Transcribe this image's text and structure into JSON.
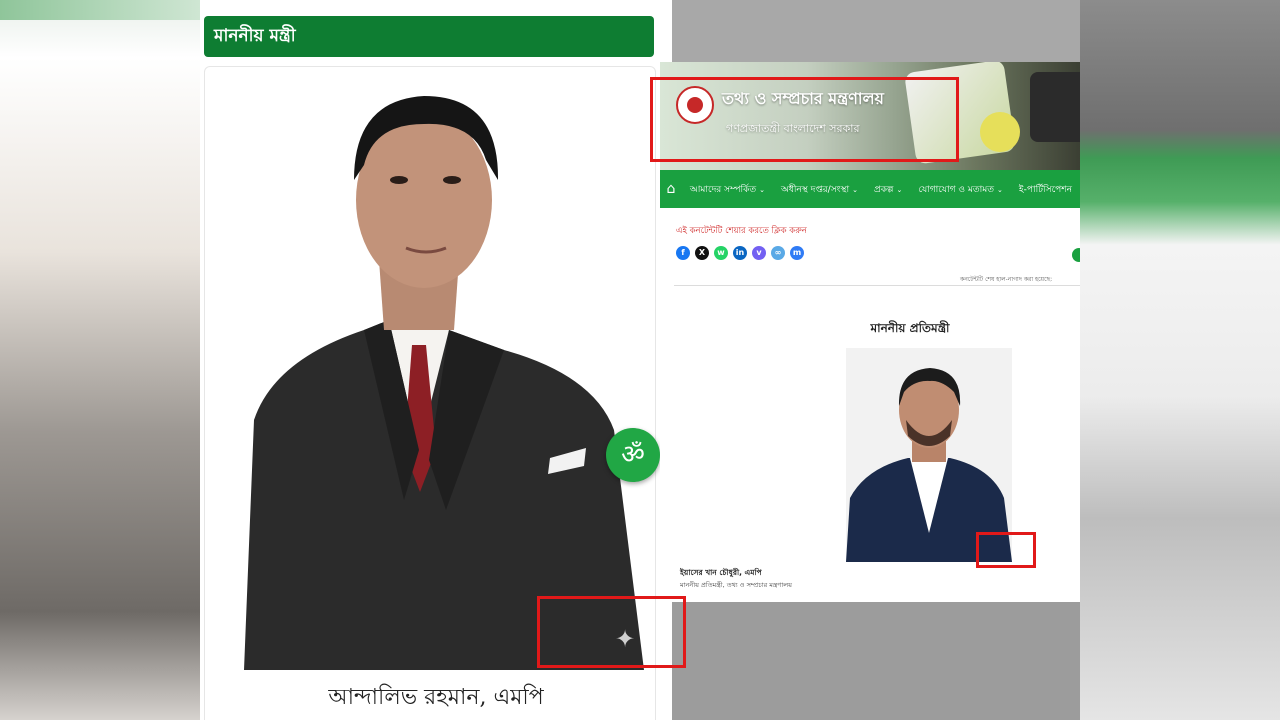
{
  "left_panel": {
    "header_title": "মাননীয় মন্ত্রী",
    "minister_name": "আন্দালিভ রহমান, এমপি",
    "accessibility_symbol": "ॐ",
    "sparkle_symbol": "✦"
  },
  "right_panel": {
    "site_title": "তথ্য ও সম্প্রচার মন্ত্রণালয়",
    "site_subtitle": "গণপ্রজাতন্ত্রী বাংলাদেশ সরকার",
    "nav": {
      "home_icon": "home-icon",
      "items": [
        "আমাদের সম্পর্কিত",
        "অধীনস্থ দপ্তর/সংস্থা",
        "প্রকল্প",
        "যোগাযোগ ও মতামত",
        "ই-পার্টিসিপেশন"
      ]
    },
    "share_prompt": "এই কনটেন্টটি শেয়ার করতে ক্লিক করুন",
    "share_icons": [
      "facebook-icon",
      "x-icon",
      "whatsapp-icon",
      "linkedin-icon",
      "viber-icon",
      "copy-link-icon",
      "messenger-icon"
    ],
    "updated_note": "কনটেন্টটি শেষ হাল-নাগাদ করা হয়েছে:",
    "deputy_heading": "মাননীয় প্রতিমন্ত্রী",
    "deputy_name": "ইয়াসের খান চৌধুরী, এমপি",
    "deputy_role": "মাননীয় প্রতিমন্ত্রী, তথ্য ও সম্প্রচার মন্ত্রণালয়"
  },
  "colors": {
    "header_green": "#0e7d32",
    "nav_green": "#1aa040",
    "annotation_red": "#e11919"
  }
}
